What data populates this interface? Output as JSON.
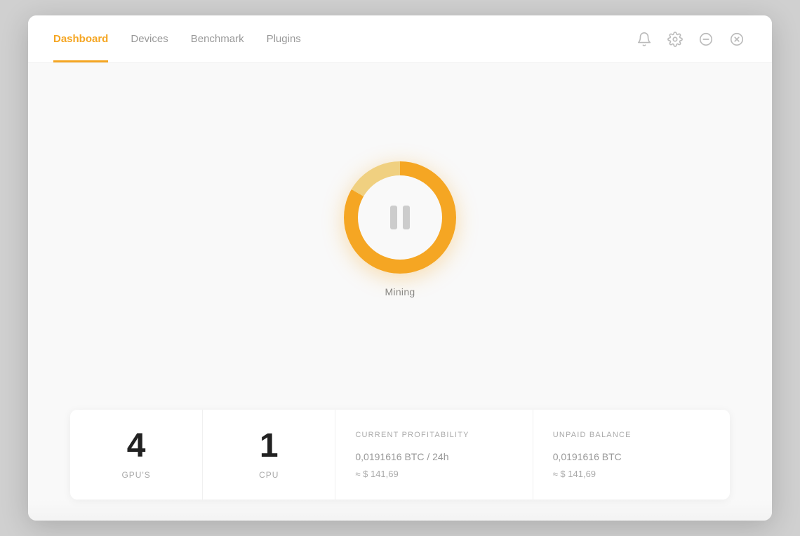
{
  "header": {
    "tabs": [
      {
        "id": "dashboard",
        "label": "Dashboard",
        "active": true
      },
      {
        "id": "devices",
        "label": "Devices",
        "active": false
      },
      {
        "id": "benchmark",
        "label": "Benchmark",
        "active": false
      },
      {
        "id": "plugins",
        "label": "Plugins",
        "active": false
      }
    ],
    "icons": [
      {
        "id": "bell",
        "symbol": "🔔",
        "name": "bell-icon"
      },
      {
        "id": "settings",
        "symbol": "⚙",
        "name": "settings-icon"
      },
      {
        "id": "minimize",
        "symbol": "⊖",
        "name": "minimize-icon"
      },
      {
        "id": "close",
        "symbol": "⊗",
        "name": "close-icon"
      }
    ]
  },
  "mining": {
    "status_label": "Mining",
    "button_title": "Pause Mining"
  },
  "stats": [
    {
      "id": "gpus",
      "number": "4",
      "label": "GPU'S",
      "type": "simple"
    },
    {
      "id": "cpu",
      "number": "1",
      "label": "CPU",
      "type": "simple"
    },
    {
      "id": "profitability",
      "title": "CURRENT PROFITABILITY",
      "value": "0,0191616",
      "unit": " BTC / 24h",
      "approx": "≈ $ 141,69",
      "type": "detail"
    },
    {
      "id": "balance",
      "title": "UNPAID BALANCE",
      "value": "0,0191616",
      "unit": " BTC",
      "approx": "≈ $ 141,69",
      "type": "detail"
    }
  ]
}
